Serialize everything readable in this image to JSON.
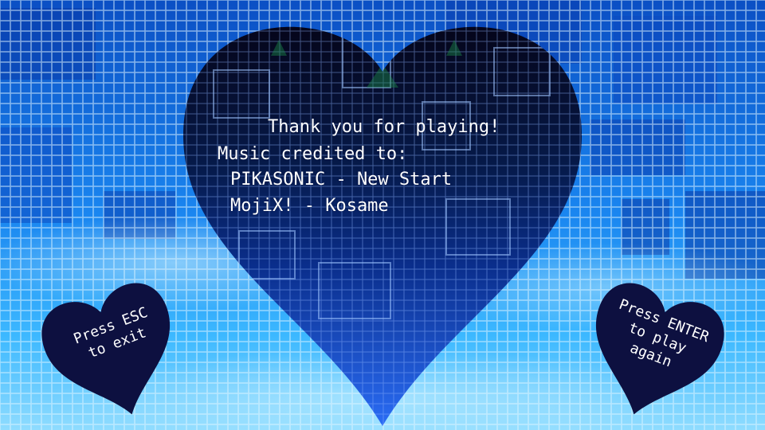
{
  "credits": {
    "line1": "Thank you for playing!",
    "line2": "Music credited to:",
    "line3": "PIKASONIC - New Start",
    "line4": "MojiX! - Kosame"
  },
  "controls": {
    "exit": {
      "line1": "Press ESC",
      "line2": "to exit"
    },
    "again": {
      "line1": "Press ENTER",
      "line2": "to play",
      "line3": "again"
    }
  },
  "colors": {
    "background_top": "#0a56c8",
    "background_bottom": "#7fd6ff",
    "grid": "#d8f0ff",
    "heart_top": "#05051a",
    "heart_bottom": "#1e5cf0",
    "button_heart": "#0d1040"
  }
}
